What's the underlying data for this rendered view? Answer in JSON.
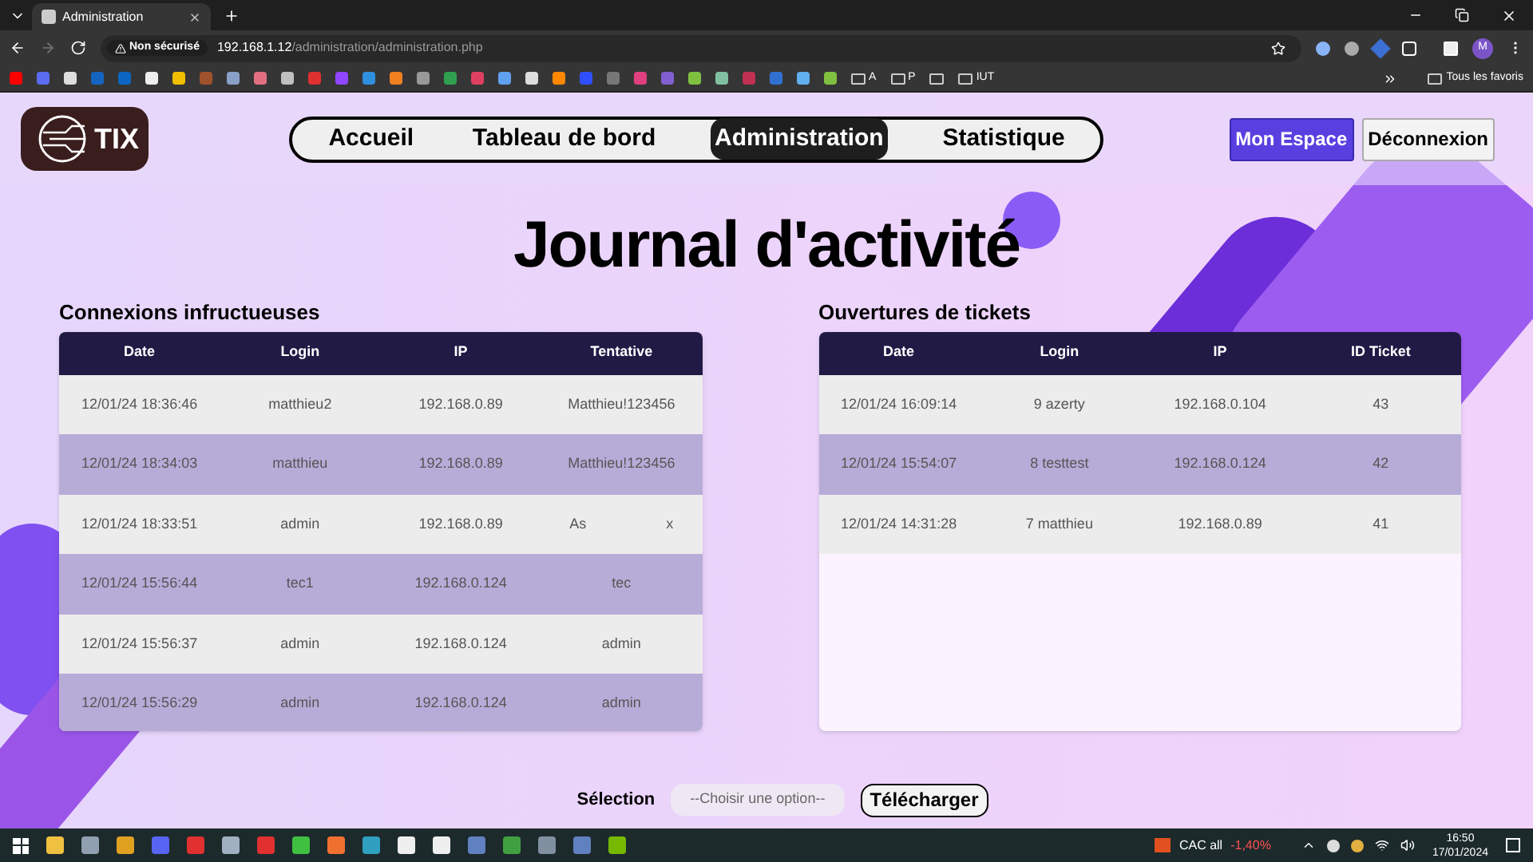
{
  "browser": {
    "tab_title": "Administration",
    "security": "Non sécurisé",
    "url_host": "192.168.1.12",
    "url_path": "/administration/administration.php",
    "bookmark_folders": [
      "A",
      "P",
      "IUT"
    ],
    "all_bookmarks": "Tous les favoris",
    "profile_initial": "M"
  },
  "nav": {
    "logo_text": "TIX",
    "links": [
      {
        "label": "Accueil",
        "selected": false
      },
      {
        "label": "Tableau de bord",
        "selected": false
      },
      {
        "label": "Administration",
        "selected": true
      },
      {
        "label": "Statistique",
        "selected": false
      }
    ],
    "account_button": "Mon Espace",
    "logout_button": "Déconnexion"
  },
  "title": "Journal d'activité",
  "failed_logins": {
    "heading": "Connexions infructueuses",
    "columns": [
      "Date",
      "Login",
      "IP",
      "Tentative"
    ],
    "rows": [
      [
        "12/01/24 18:36:46",
        "matthieu2",
        "192.168.0.89",
        "Matthieu!123456"
      ],
      [
        "12/01/24 18:34:03",
        "matthieu",
        "192.168.0.89",
        "Matthieu!123456"
      ],
      [
        "12/01/24 18:33:51",
        "admin",
        "192.168.0.89",
        "As                    x"
      ],
      [
        "12/01/24 15:56:44",
        "tec1",
        "192.168.0.124",
        "tec"
      ],
      [
        "12/01/24 15:56:37",
        "admin",
        "192.168.0.124",
        "admin"
      ],
      [
        "12/01/24 15:56:29",
        "admin",
        "192.168.0.124",
        "admin"
      ]
    ]
  },
  "ticket_openings": {
    "heading": "Ouvertures de tickets",
    "columns": [
      "Date",
      "Login",
      "IP",
      "ID Ticket"
    ],
    "rows": [
      [
        "12/01/24 16:09:14",
        "9 azerty",
        "192.168.0.104",
        "43"
      ],
      [
        "12/01/24 15:54:07",
        "8 testtest",
        "192.168.0.124",
        "42"
      ],
      [
        "12/01/24 14:31:28",
        "7 matthieu",
        "192.168.0.89",
        "41"
      ]
    ]
  },
  "export": {
    "label": "Sélection",
    "placeholder": "--Choisir une option--",
    "button": "Télécharger"
  },
  "taskbar": {
    "stock_name": "CAC all",
    "stock_change": "-1,40%",
    "time": "16:50",
    "date": "17/01/2024"
  }
}
